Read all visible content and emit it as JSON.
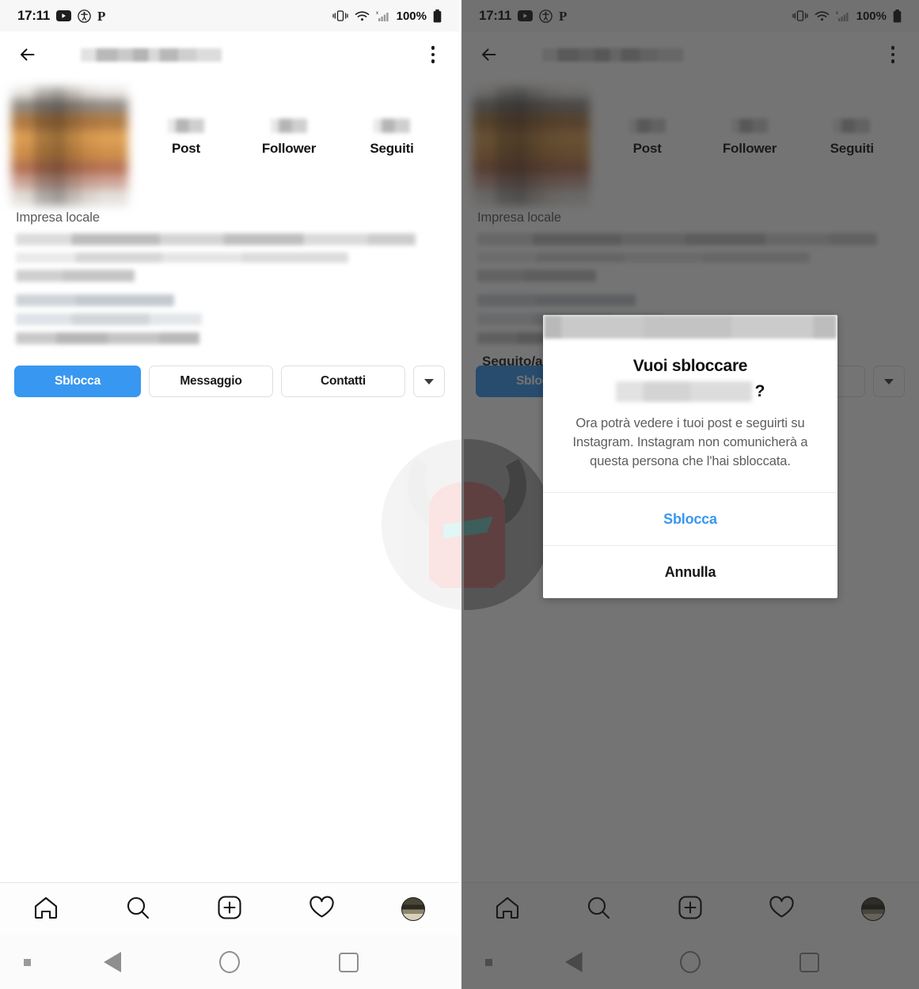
{
  "status_bar": {
    "time": "17:11",
    "battery_percent": "100%",
    "icons": [
      "youtube-icon",
      "accessibility-icon",
      "pinterest-icon",
      "vibrate-icon",
      "wifi-icon",
      "signal-icon",
      "battery-icon"
    ]
  },
  "app_bar": {
    "back_label": "back-arrow",
    "title_redacted": "",
    "menu_label": "more-options"
  },
  "profile": {
    "stats": [
      {
        "label": "Post",
        "value": ""
      },
      {
        "label": "Follower",
        "value": ""
      },
      {
        "label": "Seguiti",
        "value": ""
      }
    ],
    "category": "Impresa locale",
    "following_label": "Seguito/a"
  },
  "actions": {
    "primary": "Sblocca",
    "message": "Messaggio",
    "contacts": "Contatti",
    "more": "chevron-down-icon"
  },
  "dialog": {
    "title": "Vuoi sbloccare",
    "name_redacted": "",
    "question_mark": "?",
    "body": "Ora potrà vedere i tuoi post e seguirti su Instagram. Instagram non comunicherà a questa persona che l'hai sbloccata.",
    "confirm": "Sblocca",
    "cancel": "Annulla"
  },
  "bottom_nav": {
    "items": [
      "home-icon",
      "search-icon",
      "add-post-icon",
      "activity-heart-icon",
      "profile-avatar"
    ]
  },
  "android_nav": {
    "items": [
      "notification-dot",
      "back-icon",
      "home-icon",
      "recents-icon"
    ]
  },
  "colors": {
    "accent_blue": "#3897f0",
    "text_primary": "#101010",
    "text_secondary": "#5d5d5d",
    "border": "#dcdfe3"
  }
}
